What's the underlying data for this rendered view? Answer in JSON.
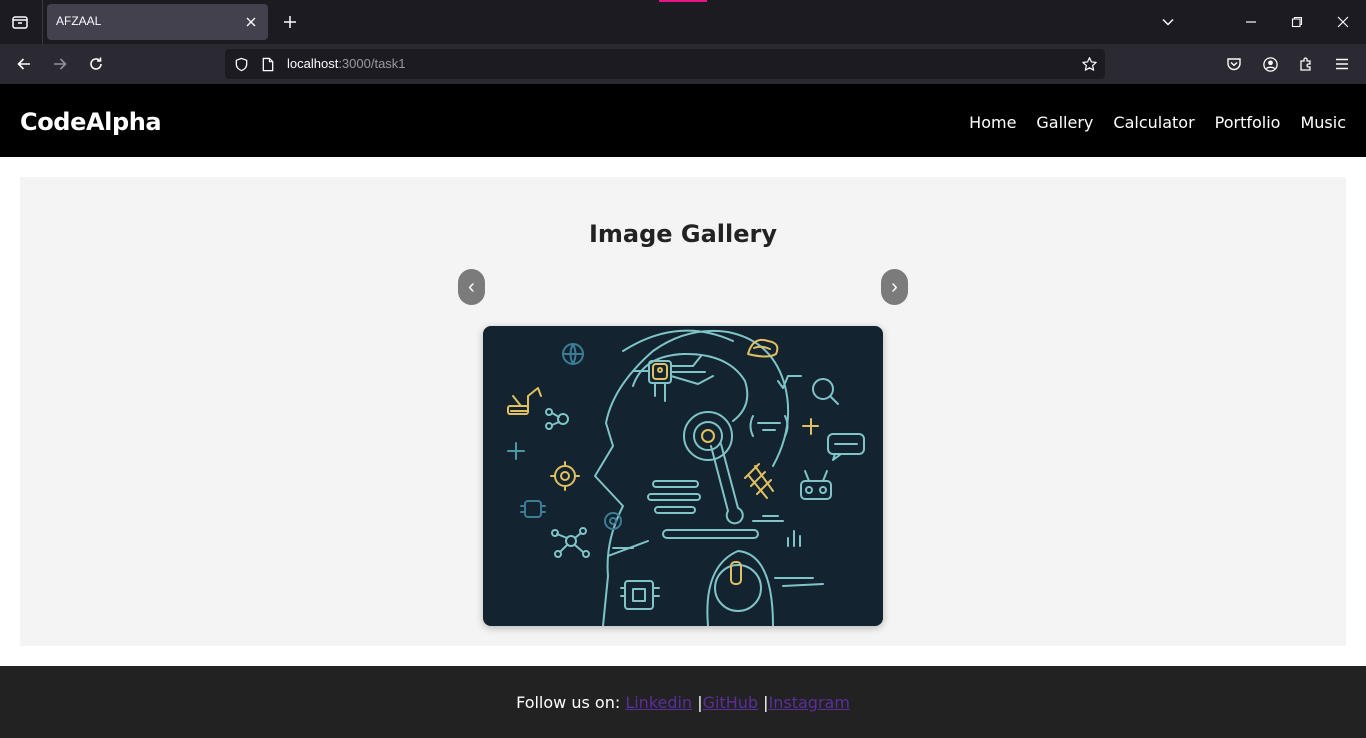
{
  "browser": {
    "tab_title": "AFZAAL",
    "url_host": "localhost",
    "url_path": ":3000/task1"
  },
  "site": {
    "brand": "CodeAlpha",
    "nav": [
      "Home",
      "Gallery",
      "Calculator",
      "Portfolio",
      "Music"
    ]
  },
  "gallery": {
    "title": "Image Gallery",
    "prev_label": "‹",
    "next_label": "›"
  },
  "footer": {
    "prefix": "Follow us on: ",
    "links": [
      "Linkedin",
      "GitHub",
      "Instagram"
    ],
    "separator": "|"
  },
  "colors": {
    "header_bg": "#000000",
    "gallery_bg": "#f4f4f4",
    "footer_bg": "#222222",
    "link": "#5b2e9c",
    "image_bg": "#13232f",
    "image_line": "#7fc4c8",
    "image_accent": "#e0c060"
  }
}
